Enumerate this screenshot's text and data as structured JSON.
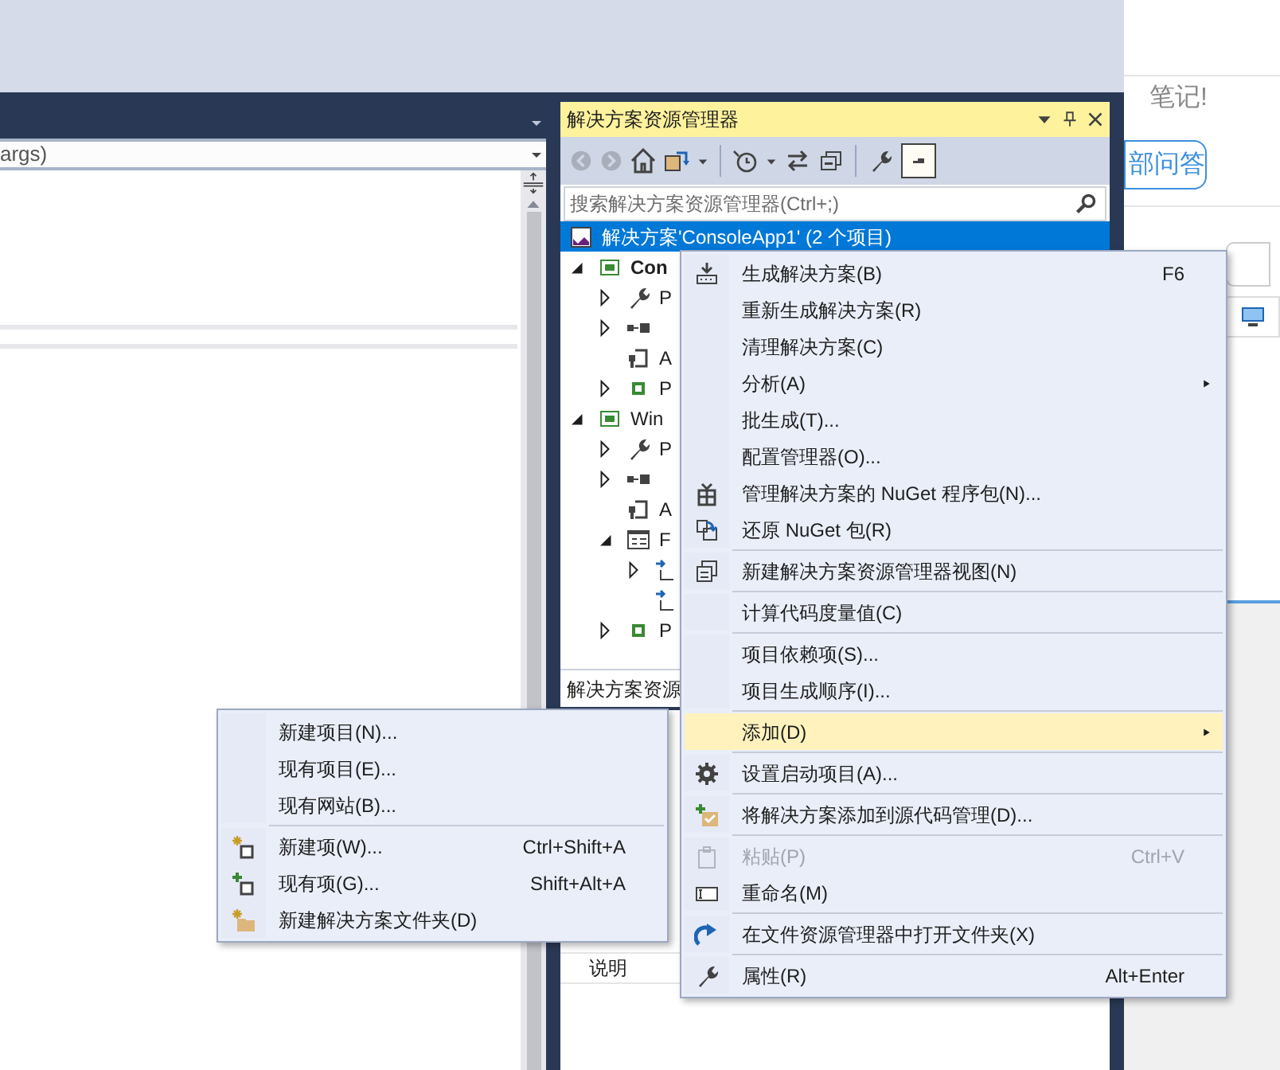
{
  "editor": {
    "navigation_text": "args)"
  },
  "browser": {
    "heading": "笔记!",
    "button": "部问答"
  },
  "solution_explorer": {
    "title": "解决方案资源管理器",
    "search": {
      "placeholder": "搜索解决方案资源管理器(Ctrl+;)"
    },
    "tree": [
      {
        "label": "解决方案'ConsoleApp1' (2 个项目)",
        "kind": "solution",
        "selected": true,
        "children": [
          {
            "label": "Con",
            "kind": "csproj",
            "bold": true,
            "expanded": true,
            "selected": false,
            "children": [
              {
                "label": "P",
                "kind": "wrench",
                "expanded": false,
                "selected": false
              },
              {
                "kind": "references",
                "expanded": false,
                "selected": false
              },
              {
                "label": "A",
                "kind": "config",
                "selected": false
              },
              {
                "label": "P",
                "kind": "csfile",
                "expanded": false,
                "selected": false
              }
            ]
          },
          {
            "label": "Win",
            "kind": "csproj",
            "bold": false,
            "expanded": true,
            "selected": false,
            "children": [
              {
                "label": "P",
                "kind": "wrench",
                "expanded": false,
                "selected": false
              },
              {
                "kind": "references",
                "expanded": false,
                "selected": false
              },
              {
                "label": "A",
                "kind": "config",
                "selected": false
              },
              {
                "label": "F",
                "kind": "form",
                "expanded": true,
                "selected": false,
                "children": [
                  {
                    "kind": "linkfile",
                    "expanded": false,
                    "selected": false
                  },
                  {
                    "kind": "linkfile",
                    "selected": false
                  }
                ]
              },
              {
                "label": "P",
                "kind": "csfile",
                "expanded": false,
                "selected": false
              }
            ]
          }
        ]
      }
    ],
    "bottom_tab": "解决方案资源"
  },
  "properties": {
    "rows": [
      "说明"
    ]
  },
  "context_menu": {
    "groups": [
      [
        {
          "label": "生成解决方案(B)",
          "shortcut": "F6",
          "kind": "build",
          "has_submenu": false,
          "highlighted": false,
          "disabled": false
        },
        {
          "label": "重新生成解决方案(R)",
          "has_submenu": false,
          "highlighted": false,
          "disabled": false
        },
        {
          "label": "清理解决方案(C)",
          "has_submenu": false,
          "highlighted": false,
          "disabled": false
        },
        {
          "label": "分析(A)",
          "has_submenu": true,
          "highlighted": false,
          "disabled": false
        },
        {
          "label": "批生成(T)...",
          "has_submenu": false,
          "highlighted": false,
          "disabled": false
        },
        {
          "label": "配置管理器(O)...",
          "has_submenu": false,
          "highlighted": false,
          "disabled": false
        },
        {
          "label": "管理解决方案的 NuGet 程序包(N)...",
          "kind": "package",
          "has_submenu": false,
          "highlighted": false,
          "disabled": false
        },
        {
          "label": "还原 NuGet 包(R)",
          "kind": "restore",
          "has_submenu": false,
          "highlighted": false,
          "disabled": false
        }
      ],
      [
        {
          "label": "新建解决方案资源管理器视图(N)",
          "kind": "windows",
          "has_submenu": false,
          "highlighted": false,
          "disabled": false
        }
      ],
      [
        {
          "label": "计算代码度量值(C)",
          "has_submenu": false,
          "highlighted": false,
          "disabled": false
        }
      ],
      [
        {
          "label": "项目依赖项(S)...",
          "has_submenu": false,
          "highlighted": false,
          "disabled": false
        },
        {
          "label": "项目生成顺序(I)...",
          "has_submenu": false,
          "highlighted": false,
          "disabled": false
        }
      ],
      [
        {
          "label": "添加(D)",
          "has_submenu": true,
          "highlighted": true,
          "disabled": false
        }
      ],
      [
        {
          "label": "设置启动项目(A)...",
          "kind": "gear",
          "has_submenu": false,
          "highlighted": false,
          "disabled": false
        }
      ],
      [
        {
          "label": "将解决方案添加到源代码管理(D)...",
          "kind": "addsource",
          "has_submenu": false,
          "highlighted": false,
          "disabled": false
        }
      ],
      [
        {
          "label": "粘贴(P)",
          "shortcut": "Ctrl+V",
          "kind": "paste",
          "has_submenu": false,
          "highlighted": false,
          "disabled": true
        },
        {
          "label": "重命名(M)",
          "kind": "rename",
          "has_submenu": false,
          "highlighted": false,
          "disabled": false
        }
      ],
      [
        {
          "label": "在文件资源管理器中打开文件夹(X)",
          "kind": "redo",
          "has_submenu": false,
          "highlighted": false,
          "disabled": false
        }
      ],
      [
        {
          "label": "属性(R)",
          "shortcut": "Alt+Enter",
          "kind": "wrench",
          "has_submenu": false,
          "highlighted": false,
          "disabled": false
        }
      ]
    ]
  },
  "add_submenu": {
    "groups": [
      [
        {
          "label": "新建项目(N)..."
        },
        {
          "label": "现有项目(E)..."
        },
        {
          "label": "现有网站(B)..."
        }
      ],
      [
        {
          "label": "新建项(W)...",
          "shortcut": "Ctrl+Shift+A",
          "kind": "newitem"
        },
        {
          "label": "现有项(G)...",
          "shortcut": "Shift+Alt+A",
          "kind": "existingitem"
        },
        {
          "label": "新建解决方案文件夹(D)",
          "kind": "newfolder"
        }
      ]
    ]
  }
}
